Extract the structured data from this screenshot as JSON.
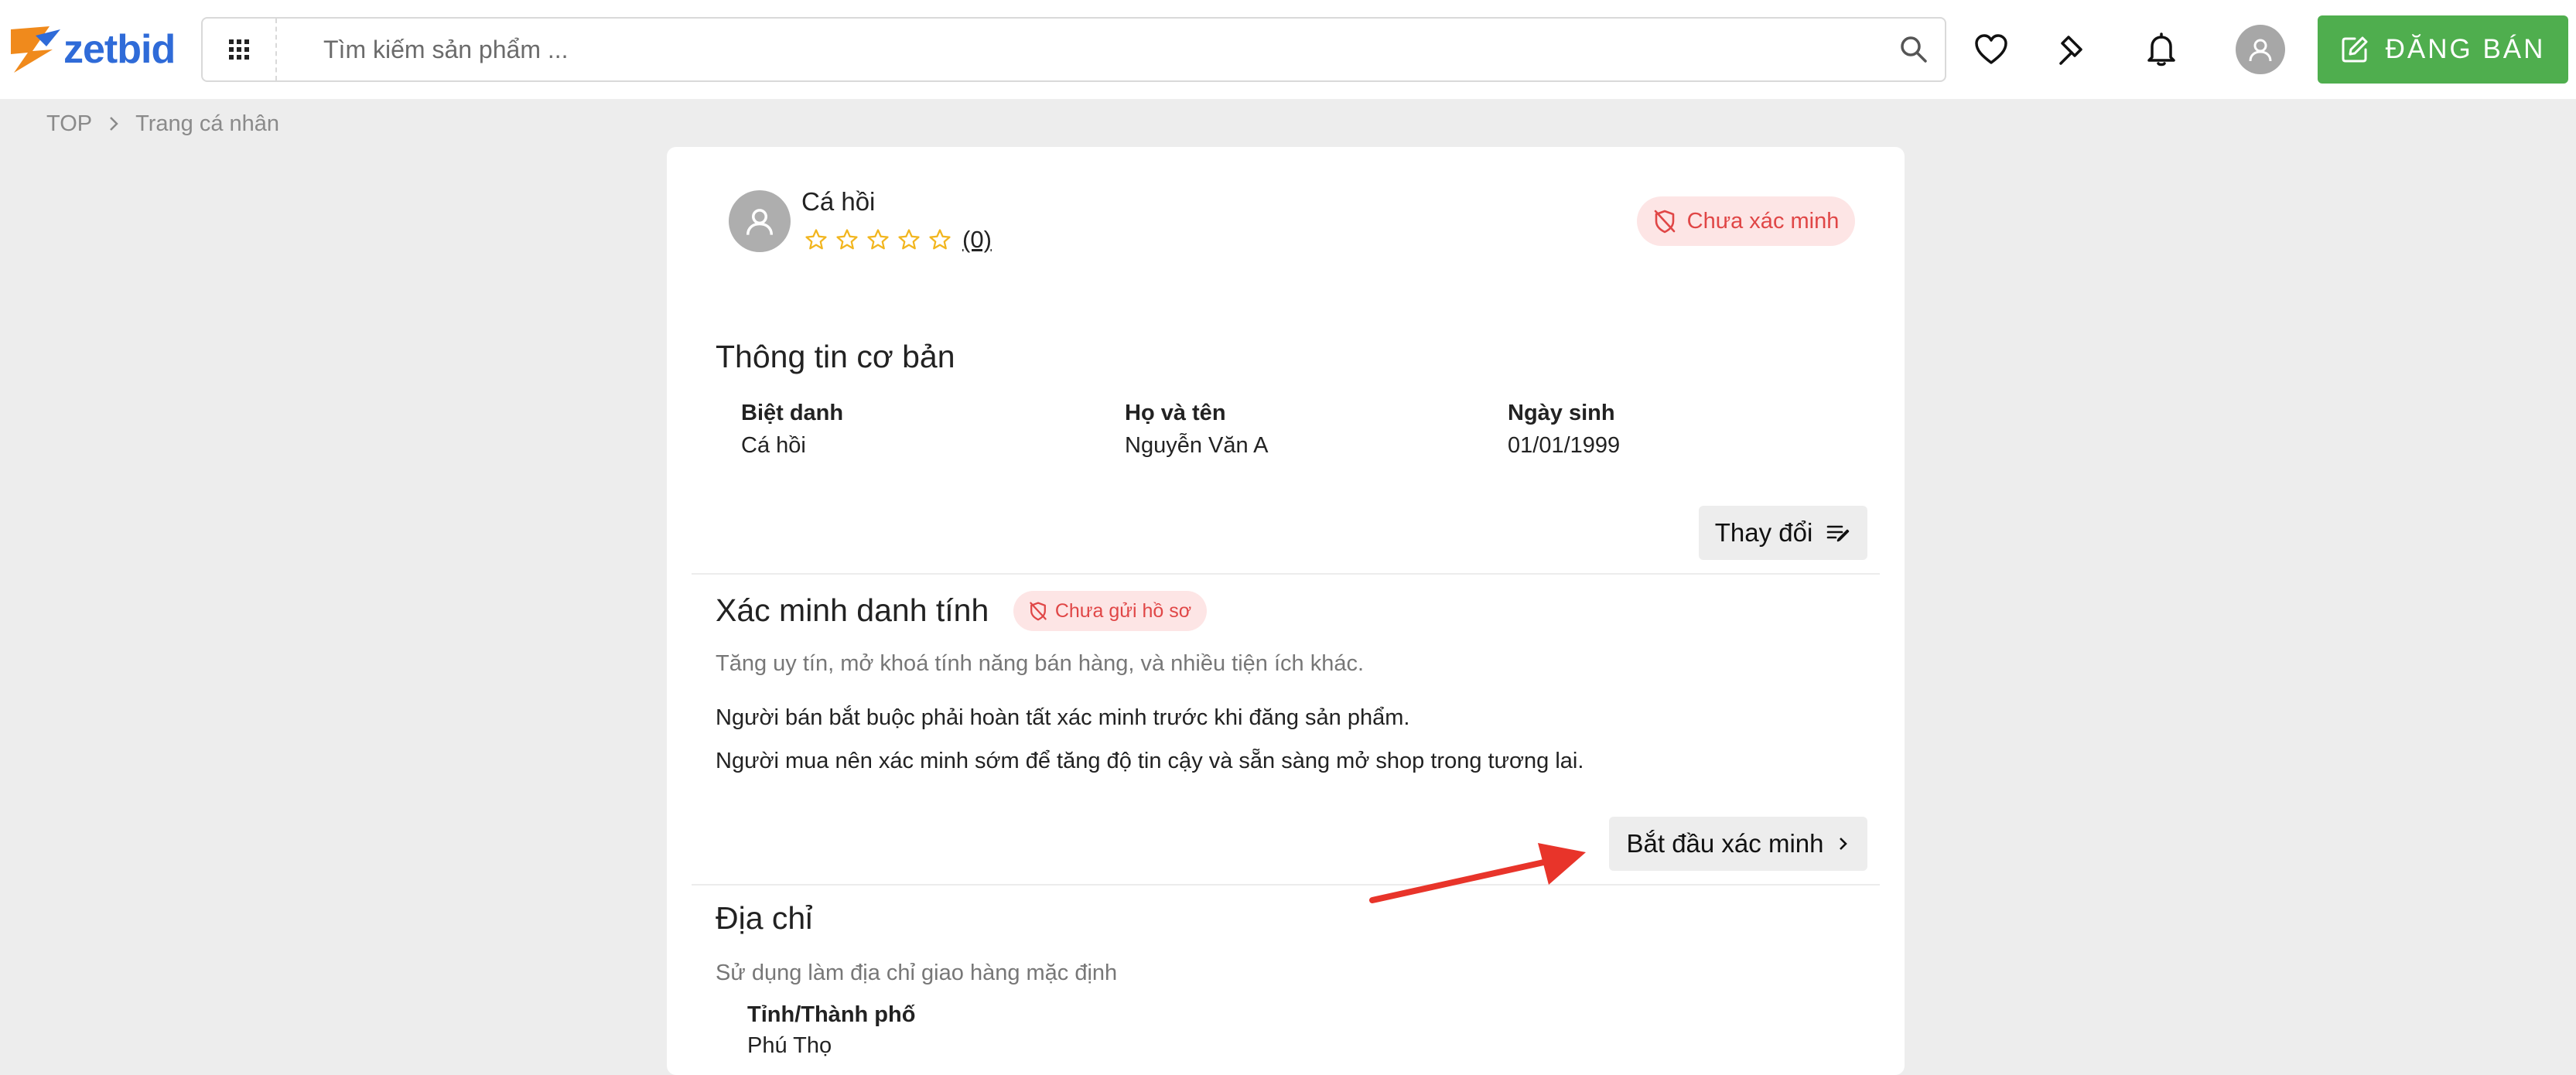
{
  "header": {
    "logo_text": "zetbid",
    "search_placeholder": "Tìm kiếm sản phẩm ...",
    "post_button_label": "ĐĂNG BÁN",
    "brand_color": "#2f6bd8",
    "accent_color": "#4fae4e",
    "icons": [
      "grid-icon",
      "search-icon",
      "heart-icon",
      "gavel-icon",
      "bell-icon",
      "user-icon",
      "edit-icon"
    ]
  },
  "breadcrumb": {
    "root": "TOP",
    "current": "Trang cá nhân"
  },
  "profile": {
    "name": "Cá hồi",
    "rating_stars": 0,
    "rating_max": 5,
    "rating_count": "(0)",
    "status_badge": "Chưa xác minh"
  },
  "basic_info": {
    "title": "Thông tin cơ bản",
    "fields": [
      {
        "label": "Biệt danh",
        "value": "Cá hồi"
      },
      {
        "label": "Họ và tên",
        "value": "Nguyễn Văn A"
      },
      {
        "label": "Ngày sinh",
        "value": "01/01/1999"
      }
    ],
    "change_button": "Thay đổi"
  },
  "verification": {
    "title": "Xác minh danh tính",
    "badge": "Chưa gửi hồ sơ",
    "subtitle": "Tăng uy tín, mở khoá tính năng bán hàng, và nhiều tiện ích khác.",
    "lines": [
      "Người bán bắt buộc phải hoàn tất xác minh trước khi đăng sản phẩm.",
      "Người mua nên xác minh sớm để tăng độ tin cậy và sẵn sàng mở shop trong tương lai."
    ],
    "start_button": "Bắt đầu xác minh"
  },
  "address": {
    "title": "Địa chỉ",
    "subtitle": "Sử dụng làm địa chỉ giao hàng mặc định",
    "field_label": "Tỉnh/Thành phố",
    "field_value": "Phú Thọ"
  }
}
